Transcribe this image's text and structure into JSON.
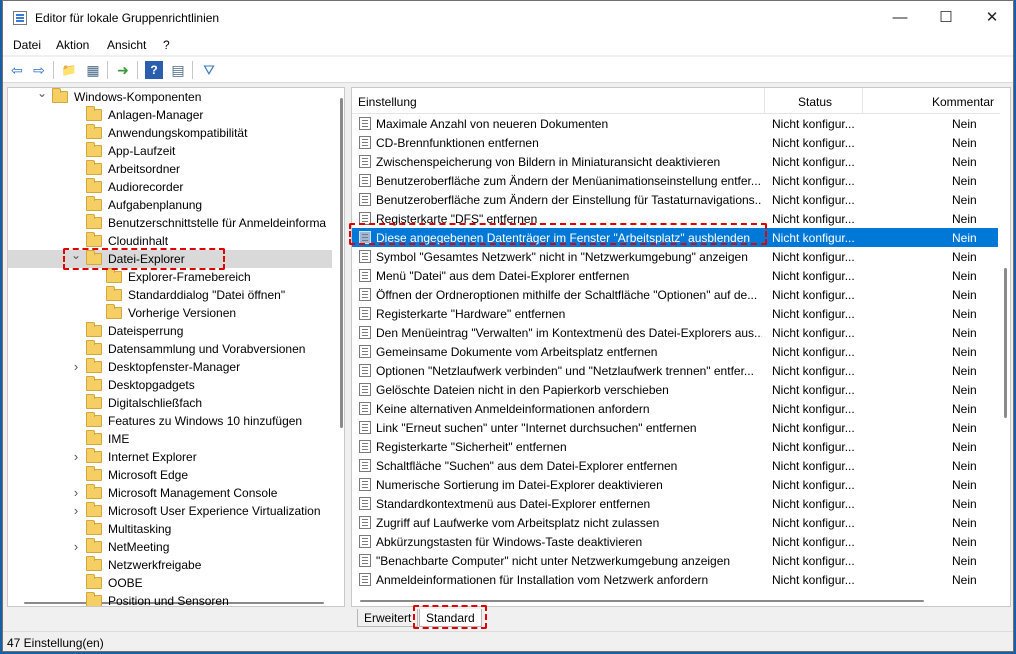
{
  "window": {
    "title": "Editor für lokale Gruppenrichtlinien",
    "minimize": "—",
    "maximize": "☐",
    "close": "✕"
  },
  "menu": [
    "Datei",
    "Aktion",
    "Ansicht",
    "?"
  ],
  "toolbar": {
    "back": "⇦",
    "forward": "⇨",
    "folder_up": "📁",
    "show_tree": "▦",
    "export": "➜",
    "help": "?",
    "properties": "▤",
    "filter": "⛛"
  },
  "tree": {
    "items": [
      {
        "label": "Windows-Komponenten",
        "level": 0,
        "expander": "expanded"
      },
      {
        "label": "Anlagen-Manager",
        "level": 1,
        "expander": "none"
      },
      {
        "label": "Anwendungskompatibilität",
        "level": 1,
        "expander": "none"
      },
      {
        "label": "App-Laufzeit",
        "level": 1,
        "expander": "none"
      },
      {
        "label": "Arbeitsordner",
        "level": 1,
        "expander": "none"
      },
      {
        "label": "Audiorecorder",
        "level": 1,
        "expander": "none"
      },
      {
        "label": "Aufgabenplanung",
        "level": 1,
        "expander": "none"
      },
      {
        "label": "Benutzerschnittstelle für Anmeldeinforma",
        "level": 1,
        "expander": "none"
      },
      {
        "label": "Cloudinhalt",
        "level": 1,
        "expander": "none"
      },
      {
        "label": "Datei-Explorer",
        "level": 1,
        "expander": "expanded",
        "selected": true
      },
      {
        "label": "Explorer-Framebereich",
        "level": 2,
        "expander": "none"
      },
      {
        "label": "Standarddialog \"Datei öffnen\"",
        "level": 2,
        "expander": "none"
      },
      {
        "label": "Vorherige Versionen",
        "level": 2,
        "expander": "none"
      },
      {
        "label": "Dateisperrung",
        "level": 1,
        "expander": "none"
      },
      {
        "label": "Datensammlung und Vorabversionen",
        "level": 1,
        "expander": "none"
      },
      {
        "label": "Desktopfenster-Manager",
        "level": 1,
        "expander": "collapsed"
      },
      {
        "label": "Desktopgadgets",
        "level": 1,
        "expander": "none"
      },
      {
        "label": "Digitalschließfach",
        "level": 1,
        "expander": "none"
      },
      {
        "label": "Features zu Windows 10 hinzufügen",
        "level": 1,
        "expander": "none"
      },
      {
        "label": "IME",
        "level": 1,
        "expander": "none"
      },
      {
        "label": "Internet Explorer",
        "level": 1,
        "expander": "collapsed"
      },
      {
        "label": "Microsoft Edge",
        "level": 1,
        "expander": "none"
      },
      {
        "label": "Microsoft Management Console",
        "level": 1,
        "expander": "collapsed"
      },
      {
        "label": "Microsoft User Experience Virtualization",
        "level": 1,
        "expander": "collapsed"
      },
      {
        "label": "Multitasking",
        "level": 1,
        "expander": "none"
      },
      {
        "label": "NetMeeting",
        "level": 1,
        "expander": "collapsed"
      },
      {
        "label": "Netzwerkfreigabe",
        "level": 1,
        "expander": "none"
      },
      {
        "label": "OOBE",
        "level": 1,
        "expander": "none"
      },
      {
        "label": "Position und Sensoren",
        "level": 1,
        "expander": "none"
      }
    ]
  },
  "list": {
    "headers": {
      "name": "Einstellung",
      "status": "Status",
      "comment": "Kommentar"
    },
    "rows": [
      {
        "name": "Maximale Anzahl von neueren Dokumenten",
        "status": "Nicht konfigur...",
        "comment": "Nein"
      },
      {
        "name": "CD-Brennfunktionen entfernen",
        "status": "Nicht konfigur...",
        "comment": "Nein"
      },
      {
        "name": "Zwischenspeicherung von Bildern in Miniaturansicht deaktivieren",
        "status": "Nicht konfigur...",
        "comment": "Nein"
      },
      {
        "name": "Benutzeroberfläche zum Ändern der Menüanimationseinstellung entfer...",
        "status": "Nicht konfigur...",
        "comment": "Nein"
      },
      {
        "name": "Benutzeroberfläche zum Ändern der Einstellung für Tastaturnavigations...",
        "status": "Nicht konfigur...",
        "comment": "Nein"
      },
      {
        "name": "Registerkarte \"DFS\" entfernen",
        "status": "Nicht konfigur...",
        "comment": "Nein"
      },
      {
        "name": "Diese angegebenen Datenträger im Fenster \"Arbeitsplatz\" ausblenden",
        "status": "Nicht konfigur...",
        "comment": "Nein",
        "selected": true
      },
      {
        "name": "Symbol \"Gesamtes Netzwerk\" nicht in \"Netzwerkumgebung\" anzeigen",
        "status": "Nicht konfigur...",
        "comment": "Nein"
      },
      {
        "name": "Menü \"Datei\" aus dem Datei-Explorer entfernen",
        "status": "Nicht konfigur...",
        "comment": "Nein"
      },
      {
        "name": "Öffnen der Ordneroptionen mithilfe der Schaltfläche \"Optionen\" auf de...",
        "status": "Nicht konfigur...",
        "comment": "Nein"
      },
      {
        "name": "Registerkarte \"Hardware\" entfernen",
        "status": "Nicht konfigur...",
        "comment": "Nein"
      },
      {
        "name": "Den Menüeintrag \"Verwalten\" im Kontextmenü des Datei-Explorers aus...",
        "status": "Nicht konfigur...",
        "comment": "Nein"
      },
      {
        "name": "Gemeinsame Dokumente vom Arbeitsplatz entfernen",
        "status": "Nicht konfigur...",
        "comment": "Nein"
      },
      {
        "name": "Optionen \"Netzlaufwerk verbinden\" und \"Netzlaufwerk trennen\" entfer...",
        "status": "Nicht konfigur...",
        "comment": "Nein"
      },
      {
        "name": "Gelöschte Dateien nicht in den Papierkorb verschieben",
        "status": "Nicht konfigur...",
        "comment": "Nein"
      },
      {
        "name": "Keine alternativen Anmeldeinformationen anfordern",
        "status": "Nicht konfigur...",
        "comment": "Nein"
      },
      {
        "name": "Link \"Erneut suchen\" unter \"Internet durchsuchen\" entfernen",
        "status": "Nicht konfigur...",
        "comment": "Nein"
      },
      {
        "name": "Registerkarte \"Sicherheit\" entfernen",
        "status": "Nicht konfigur...",
        "comment": "Nein"
      },
      {
        "name": "Schaltfläche \"Suchen\" aus dem Datei-Explorer entfernen",
        "status": "Nicht konfigur...",
        "comment": "Nein"
      },
      {
        "name": "Numerische Sortierung im Datei-Explorer deaktivieren",
        "status": "Nicht konfigur...",
        "comment": "Nein"
      },
      {
        "name": "Standardkontextmenü aus Datei-Explorer entfernen",
        "status": "Nicht konfigur...",
        "comment": "Nein"
      },
      {
        "name": "Zugriff auf Laufwerke vom Arbeitsplatz nicht zulassen",
        "status": "Nicht konfigur...",
        "comment": "Nein"
      },
      {
        "name": "Abkürzungstasten für Windows-Taste deaktivieren",
        "status": "Nicht konfigur...",
        "comment": "Nein"
      },
      {
        "name": "\"Benachbarte Computer\" nicht unter Netzwerkumgebung anzeigen",
        "status": "Nicht konfigur...",
        "comment": "Nein"
      },
      {
        "name": "Anmeldeinformationen für Installation vom Netzwerk anfordern",
        "status": "Nicht konfigur...",
        "comment": "Nein"
      }
    ]
  },
  "tabs": [
    {
      "label": "Erweitert",
      "active": false
    },
    {
      "label": "Standard",
      "active": true
    }
  ],
  "statusbar": {
    "text": "47 Einstellung(en)"
  },
  "colors": {
    "selection": "#0078d7",
    "highlight_dash": "#e00000",
    "folder": "#f5cf64"
  }
}
